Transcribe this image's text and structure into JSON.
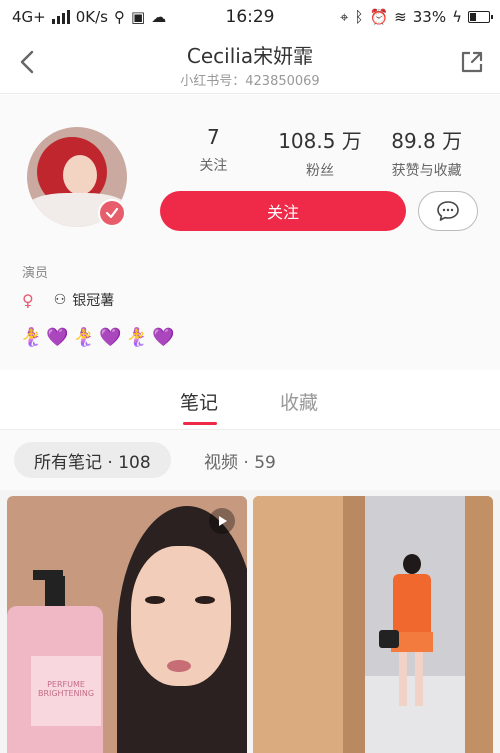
{
  "status_bar": {
    "network": "4G+",
    "speed": "0K/s",
    "time": "16:29",
    "battery": "33%"
  },
  "header": {
    "name": "Cecilia宋妍霏",
    "id_line": "小红书号：423850069",
    "back_icon": "chevron-left-icon",
    "share_icon": "share-icon"
  },
  "profile": {
    "stats": [
      {
        "value": "7",
        "label": "关注"
      },
      {
        "value": "108.5 万",
        "label": "粉丝"
      },
      {
        "value": "89.8 万",
        "label": "获赞与收藏"
      }
    ],
    "follow_label": "关注",
    "occupation": "演员",
    "gender_symbol": "♀",
    "badge_label": "银冠薯",
    "emoji_line": [
      "🧜‍♀️",
      "💜",
      "🧜‍♀️",
      "💜",
      "🧜‍♀️",
      "💜"
    ]
  },
  "tabs": [
    {
      "label": "笔记",
      "active": true
    },
    {
      "label": "收藏",
      "active": false
    }
  ],
  "filters": {
    "all_notes": "所有笔记 · 108",
    "videos": "视频 · 59"
  },
  "cards": [
    {
      "type": "video",
      "product_text": "PERFUME BRIGHTENING"
    },
    {
      "type": "image"
    }
  ],
  "colors": {
    "accent": "#ee2a48",
    "verified": "#e85d6b"
  }
}
